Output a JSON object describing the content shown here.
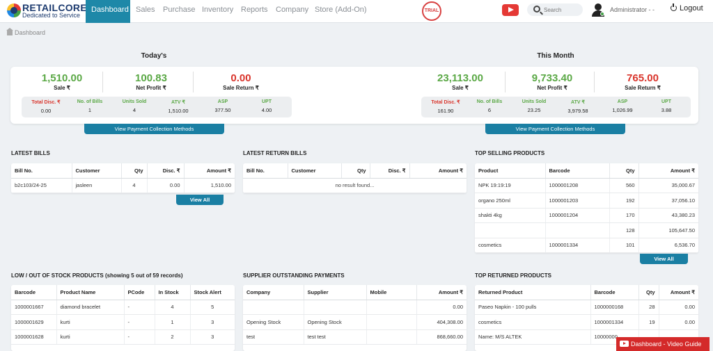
{
  "brand": {
    "name": "RETAILCORE",
    "tagline": "Dedicated to Service",
    "trial_badge": "TRIAL"
  },
  "nav": [
    "Dashboard",
    "Sales",
    "Purchase",
    "Inventory",
    "Reports",
    "Company",
    "Store (Add-On)"
  ],
  "search_placeholder": "Search",
  "user": {
    "name": "Administrator - -",
    "logout": "Logout"
  },
  "breadcrumb": "Dashboard",
  "today": {
    "title": "Today's",
    "kpis": [
      {
        "value": "1,510.00",
        "label": "Sale ₹"
      },
      {
        "value": "100.83",
        "label": "Net Profit ₹"
      },
      {
        "value": "0.00",
        "label": "Sale Return ₹"
      }
    ],
    "stats": [
      {
        "label": "Total Disc. ₹",
        "value": "0.00"
      },
      {
        "label": "No. of Bills",
        "value": "1"
      },
      {
        "label": "Units Sold",
        "value": "4"
      },
      {
        "label": "ATV ₹",
        "value": "1,510.00"
      },
      {
        "label": "ASP",
        "value": "377.50"
      },
      {
        "label": "UPT",
        "value": "4.00"
      }
    ],
    "payment_button": "View Payment Collection Methods"
  },
  "month": {
    "title": "This Month",
    "kpis": [
      {
        "value": "23,113.00",
        "label": "Sale ₹"
      },
      {
        "value": "9,733.40",
        "label": "Net Profit ₹"
      },
      {
        "value": "765.00",
        "label": "Sale Return ₹"
      }
    ],
    "stats": [
      {
        "label": "Total Disc. ₹",
        "value": "161.90"
      },
      {
        "label": "No. of Bills",
        "value": "6"
      },
      {
        "label": "Units Sold",
        "value": "23.25"
      },
      {
        "label": "ATV ₹",
        "value": "3,979.58"
      },
      {
        "label": "ASP",
        "value": "1,026.99"
      },
      {
        "label": "UPT",
        "value": "3.88"
      }
    ],
    "payment_button": "View Payment Collection Methods"
  },
  "latest_bills": {
    "title": "LATEST BILLS",
    "columns": [
      "Bill No.",
      "Customer",
      "Qty",
      "Disc. ₹",
      "Amount ₹"
    ],
    "rows": [
      [
        "b2c103/24-25",
        "jasleen",
        "4",
        "0.00",
        "1,510.00"
      ]
    ],
    "view_all": "View All"
  },
  "latest_returns": {
    "title": "LATEST RETURN BILLS",
    "columns": [
      "Bill No.",
      "Customer",
      "Qty",
      "Disc. ₹",
      "Amount ₹"
    ],
    "empty": "no result found..."
  },
  "top_selling": {
    "title": "TOP SELLING PRODUCTS",
    "columns": [
      "Product",
      "Barcode",
      "Qty",
      "Amount ₹"
    ],
    "rows": [
      [
        "NPK 19:19:19",
        "1000001208",
        "560",
        "35,000.67"
      ],
      [
        "organo 250ml",
        "1000001203",
        "192",
        "37,056.10"
      ],
      [
        "shakti 4kg",
        "1000001204",
        "170",
        "43,380.23"
      ],
      [
        "",
        "",
        "128",
        "105,647.50"
      ],
      [
        "cosmetics",
        "1000001334",
        "101",
        "6,536.70"
      ]
    ],
    "view_all": "View All"
  },
  "low_stock": {
    "title": "LOW / OUT OF STOCK PRODUCTS (showing 5 out of 59 records)",
    "columns": [
      "Barcode",
      "Product Name",
      "PCode",
      "In Stock",
      "Stock Alert"
    ],
    "rows": [
      [
        "1000001667",
        "diamond bracelet",
        "-",
        "4",
        "5"
      ],
      [
        "1000001629",
        "kurti",
        "-",
        "1",
        "3"
      ],
      [
        "1000001628",
        "kurti",
        "-",
        "2",
        "3"
      ]
    ]
  },
  "supplier_outstanding": {
    "title": "SUPPLIER OUTSTANDING PAYMENTS",
    "columns": [
      "Company",
      "Supplier",
      "Mobile",
      "Amount ₹"
    ],
    "rows": [
      [
        "",
        "",
        "",
        "0.00"
      ],
      [
        "Opening Stock",
        "Opening Stock",
        "",
        "404,308.00"
      ],
      [
        "test",
        "test test",
        "",
        "868,660.00"
      ]
    ]
  },
  "top_returned": {
    "title": "TOP RETURNED PRODUCTS",
    "columns": [
      "Returned Product",
      "Barcode",
      "Qty",
      "Amount ₹"
    ],
    "rows": [
      [
        "Paseo Napkin - 100 pulls",
        "1000000168",
        "28",
        "0.00"
      ],
      [
        "cosmetics",
        "1000001334",
        "19",
        "0.00"
      ],
      [
        "Name: M/S ALTEK",
        "10000000",
        "",
        ""
      ]
    ]
  },
  "video_guide": "Dashboard - Video Guide"
}
